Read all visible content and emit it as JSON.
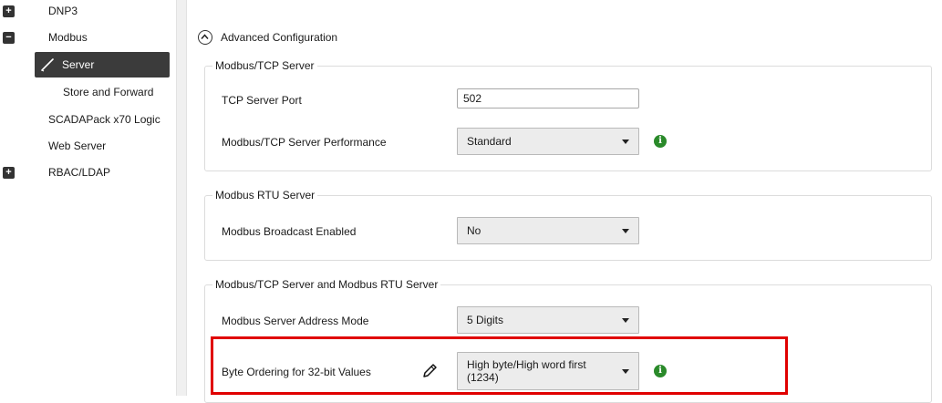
{
  "sidebar": {
    "items": [
      {
        "label": "DNP3",
        "toggle": "+"
      },
      {
        "label": "Modbus",
        "toggle": "−"
      },
      {
        "label": "Server",
        "selected": true,
        "icon": "pencil-icon"
      },
      {
        "label": "Store and Forward"
      },
      {
        "label": "SCADAPack x70 Logic"
      },
      {
        "label": "Web Server"
      },
      {
        "label": "RBAC/LDAP",
        "toggle": "+"
      }
    ]
  },
  "main": {
    "section_title": "Advanced Configuration",
    "groups": [
      {
        "title": "Modbus/TCP Server",
        "fields": [
          {
            "label": "TCP Server Port",
            "value": "502"
          },
          {
            "label": "Modbus/TCP Server Performance",
            "value": "Standard"
          }
        ]
      },
      {
        "title": "Modbus RTU Server",
        "fields": [
          {
            "label": "Modbus Broadcast Enabled",
            "value": "No"
          }
        ]
      },
      {
        "title": "Modbus/TCP Server and Modbus RTU Server",
        "fields": [
          {
            "label": "Modbus Server Address Mode",
            "value": "5 Digits"
          },
          {
            "label": "Byte Ordering for 32-bit Values",
            "value_line1": "High byte/High word first",
            "value_line2": "(1234)"
          }
        ]
      }
    ],
    "info_icon_glyph": "i"
  },
  "colors": {
    "highlight": "#e00000",
    "info": "#2a8a2a",
    "selected_bg": "#3b3b3b"
  }
}
